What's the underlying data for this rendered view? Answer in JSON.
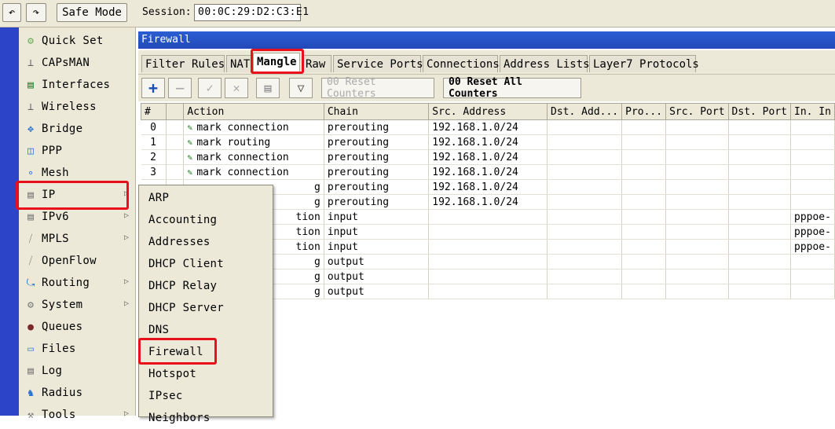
{
  "toolbar": {
    "undo_icon": "undo-icon",
    "redo_icon": "redo-icon",
    "safe_mode_label": "Safe Mode",
    "session_label": "Session:",
    "session_value": "00:0C:29:D2:C3:E1"
  },
  "sidebar": {
    "items": [
      {
        "label": "Quick Set",
        "icon": "quickset-icon"
      },
      {
        "label": "CAPsMAN",
        "icon": "capsman-icon"
      },
      {
        "label": "Interfaces",
        "icon": "interfaces-icon"
      },
      {
        "label": "Wireless",
        "icon": "wireless-icon"
      },
      {
        "label": "Bridge",
        "icon": "bridge-icon"
      },
      {
        "label": "PPP",
        "icon": "ppp-icon"
      },
      {
        "label": "Mesh",
        "icon": "mesh-icon"
      },
      {
        "label": "IP",
        "icon": "ip-icon"
      },
      {
        "label": "IPv6",
        "icon": "ipv6-icon"
      },
      {
        "label": "MPLS",
        "icon": "mpls-icon"
      },
      {
        "label": "OpenFlow",
        "icon": "openflow-icon"
      },
      {
        "label": "Routing",
        "icon": "routing-icon"
      },
      {
        "label": "System",
        "icon": "system-icon"
      },
      {
        "label": "Queues",
        "icon": "queues-icon"
      },
      {
        "label": "Files",
        "icon": "files-icon"
      },
      {
        "label": "Log",
        "icon": "log-icon"
      },
      {
        "label": "Radius",
        "icon": "radius-icon"
      },
      {
        "label": "Tools",
        "icon": "tools-icon"
      }
    ]
  },
  "window": {
    "title": "Firewall",
    "tabs": [
      "Filter Rules",
      "NAT",
      "Mangle",
      "Raw",
      "Service Ports",
      "Connections",
      "Address Lists",
      "Layer7 Protocols"
    ],
    "active_tab": "Mangle",
    "reset_counters": "00 Reset Counters",
    "reset_all_counters": "00 Reset All Counters"
  },
  "table": {
    "columns": [
      "#",
      "Action",
      "Chain",
      "Src. Address",
      "Dst. Add...",
      "Pro...",
      "Src. Port",
      "Dst. Port",
      "In. In"
    ],
    "rows": [
      {
        "num": "0",
        "action": "mark connection",
        "chain": "prerouting",
        "src": "192.168.1.0/24",
        "inif": ""
      },
      {
        "num": "1",
        "action": "mark routing",
        "chain": "prerouting",
        "src": "192.168.1.0/24",
        "inif": ""
      },
      {
        "num": "2",
        "action": "mark connection",
        "chain": "prerouting",
        "src": "192.168.1.0/24",
        "inif": ""
      },
      {
        "num": "3",
        "action": "mark connection",
        "chain": "prerouting",
        "src": "192.168.1.0/24",
        "inif": ""
      },
      {
        "num": "",
        "action": "g",
        "chain": "prerouting",
        "src": "192.168.1.0/24",
        "inif": ""
      },
      {
        "num": "",
        "action": "g",
        "chain": "prerouting",
        "src": "192.168.1.0/24",
        "inif": ""
      },
      {
        "num": "",
        "action": "tion",
        "chain": "input",
        "src": "",
        "inif": "pppoe-"
      },
      {
        "num": "",
        "action": "tion",
        "chain": "input",
        "src": "",
        "inif": "pppoe-"
      },
      {
        "num": "",
        "action": "tion",
        "chain": "input",
        "src": "",
        "inif": "pppoe-"
      },
      {
        "num": "",
        "action": "g",
        "chain": "output",
        "src": "",
        "inif": ""
      },
      {
        "num": "",
        "action": "g",
        "chain": "output",
        "src": "",
        "inif": ""
      },
      {
        "num": "",
        "action": "g",
        "chain": "output",
        "src": "",
        "inif": ""
      }
    ]
  },
  "submenu": {
    "items": [
      "ARP",
      "Accounting",
      "Addresses",
      "DHCP Client",
      "DHCP Relay",
      "DHCP Server",
      "DNS",
      "Firewall",
      "Hotspot",
      "IPsec",
      "Neighbors"
    ]
  },
  "highlight_color": "#e8101a"
}
